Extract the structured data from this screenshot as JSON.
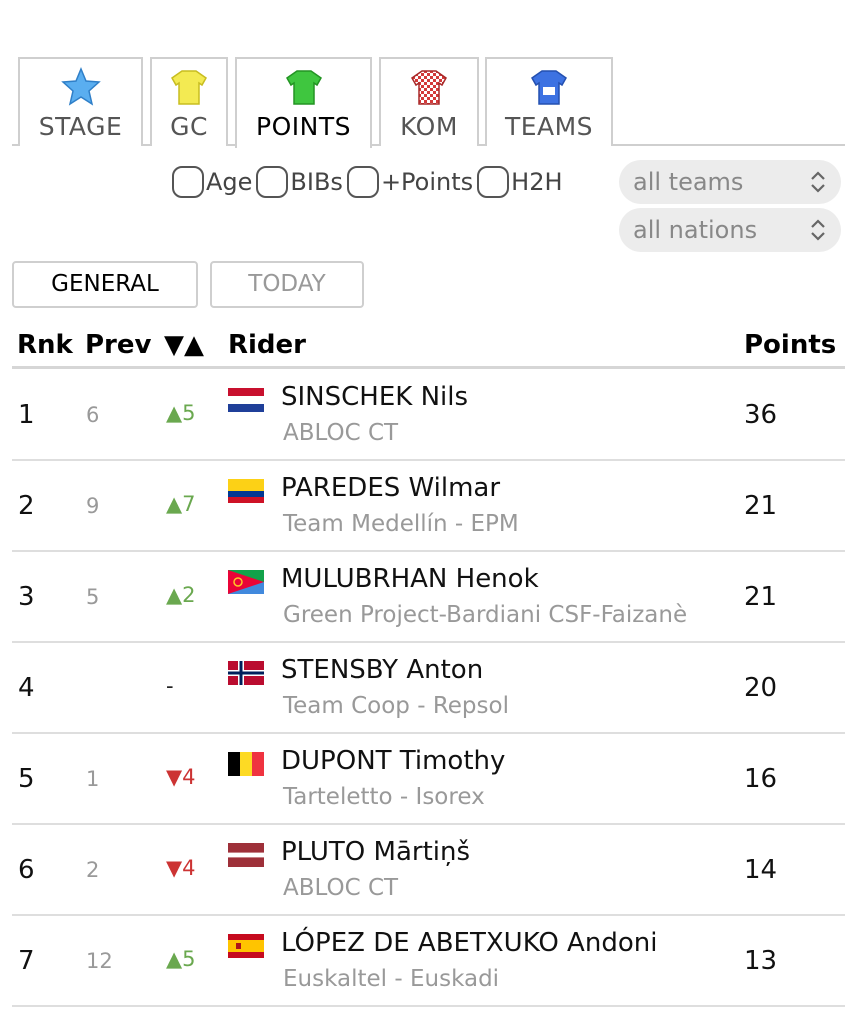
{
  "tabs": [
    {
      "label": "STAGE",
      "icon": "star-icon",
      "color": "#4a9fe8"
    },
    {
      "label": "GC",
      "icon": "yellow-jersey-icon",
      "color": "#f0e84a"
    },
    {
      "label": "POINTS",
      "icon": "green-jersey-icon",
      "color": "#3cc23c",
      "active": true
    },
    {
      "label": "KOM",
      "icon": "checkered-jersey-icon",
      "color": "#d43a3a"
    },
    {
      "label": "TEAMS",
      "icon": "blue-jersey-icon",
      "color": "#3a6ee0"
    }
  ],
  "filters": {
    "checkboxes": [
      "Age",
      "BIBs",
      "+Points",
      "H2H"
    ],
    "team_select": "all teams",
    "nation_select": "all nations"
  },
  "segments": {
    "general": "GENERAL",
    "today": "TODAY"
  },
  "table": {
    "headers": {
      "rnk": "Rnk",
      "prev": "Prev",
      "delta": "▼▲",
      "rider": "Rider",
      "points": "Points"
    },
    "rows": [
      {
        "rnk": "1",
        "prev": "6",
        "delta": "▲5",
        "dir": "up",
        "flag": "netherlands-flag",
        "rider": "SINSCHEK Nils",
        "team": "ABLOC CT",
        "points": "36"
      },
      {
        "rnk": "2",
        "prev": "9",
        "delta": "▲7",
        "dir": "up",
        "flag": "colombia-flag",
        "rider": "PAREDES Wilmar",
        "team": "Team Medellín - EPM",
        "points": "21"
      },
      {
        "rnk": "3",
        "prev": "5",
        "delta": "▲2",
        "dir": "up",
        "flag": "eritrea-flag",
        "rider": "MULUBRHAN Henok",
        "team": "Green Project-Bardiani CSF-Faizanè",
        "points": "21"
      },
      {
        "rnk": "4",
        "prev": "",
        "delta": "-",
        "dir": "none",
        "flag": "norway-flag",
        "rider": "STENSBY Anton",
        "team": "Team Coop - Repsol",
        "points": "20"
      },
      {
        "rnk": "5",
        "prev": "1",
        "delta": "▼4",
        "dir": "down",
        "flag": "belgium-flag",
        "rider": "DUPONT Timothy",
        "team": "Tarteletto - Isorex",
        "points": "16"
      },
      {
        "rnk": "6",
        "prev": "2",
        "delta": "▼4",
        "dir": "down",
        "flag": "latvia-flag",
        "rider": "PLUTO Mārtiņš",
        "team": "ABLOC CT",
        "points": "14"
      },
      {
        "rnk": "7",
        "prev": "12",
        "delta": "▲5",
        "dir": "up",
        "flag": "spain-flag",
        "rider": "LÓPEZ DE ABETXUKO Andoni",
        "team": "Euskaltel - Euskadi",
        "points": "13"
      }
    ]
  }
}
